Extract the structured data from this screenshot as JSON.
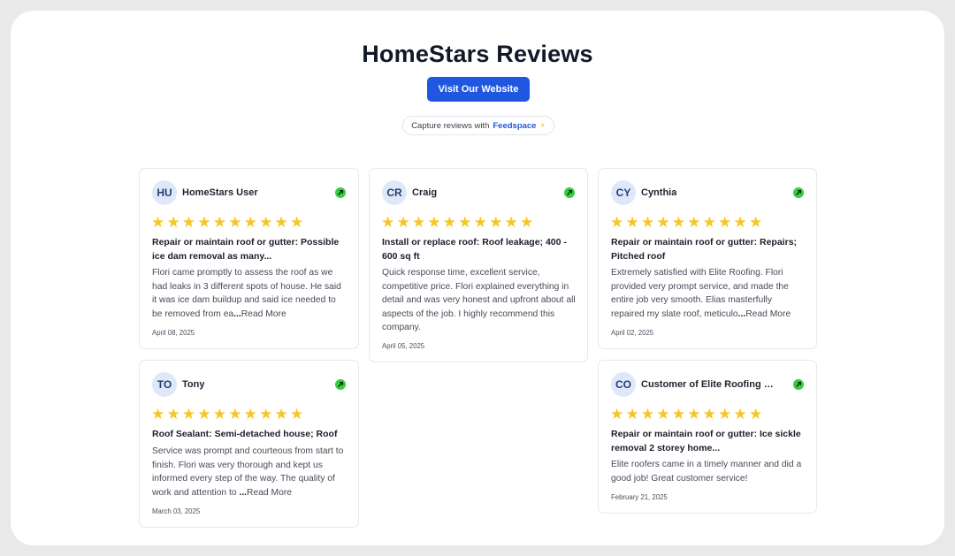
{
  "header": {
    "title": "HomeStars Reviews",
    "visit_button": "Visit Our Website",
    "capture_text": "Capture reviews with",
    "capture_brand": "Feedspace",
    "capture_bolt": "⚡"
  },
  "stars_text": "★★★★★★★★★★",
  "read_more": "Read More",
  "reviews": [
    {
      "initials": "HU",
      "name": "HomeStars User",
      "rating": 10,
      "title": "Repair or maintain roof or gutter: Possible ice dam removal as many...",
      "body": "Flori came promptly to assess the roof as we had leaks in 3 different spots of house. He said it was ice dam buildup and said ice needed to be removed from ea",
      "truncated": true,
      "date": "April 08, 2025"
    },
    {
      "initials": "CR",
      "name": "Craig",
      "rating": 10,
      "title": "Install or replace roof: Roof leakage; 400 - 600 sq ft",
      "body": "Quick response time, excellent service, competitive price. Flori explained everything in detail and was very honest and upfront about all aspects of the job. I highly recommend this company.",
      "truncated": false,
      "date": "April 05, 2025"
    },
    {
      "initials": "CY",
      "name": "Cynthia",
      "rating": 10,
      "title": "Repair or maintain roof or gutter: Repairs; Pitched roof",
      "body": "Extremely satisfied with Elite Roofing. Flori provided very prompt service, and made the entire job very smooth. Elias masterfully repaired my slate roof, meticulo",
      "truncated": true,
      "date": "April 02, 2025"
    },
    {
      "initials": "TO",
      "name": "Tony",
      "rating": 10,
      "title": "Roof Sealant: Semi-detached house; Roof",
      "body": "Service was prompt and courteous from start to finish. Flori was very thorough and kept us informed every step of the way. The quality of work and attention to",
      "truncated": true,
      "date": "March 03, 2025"
    },
    {
      "initials": "CO",
      "name": "Customer of Elite Roofing I...",
      "rating": 10,
      "title": "Repair or maintain roof or gutter: Ice sickle removal 2 storey home...",
      "body": "Elite roofers came in a timely manner and did a good job! Great customer service!",
      "truncated": false,
      "date": "February 21, 2025"
    }
  ]
}
